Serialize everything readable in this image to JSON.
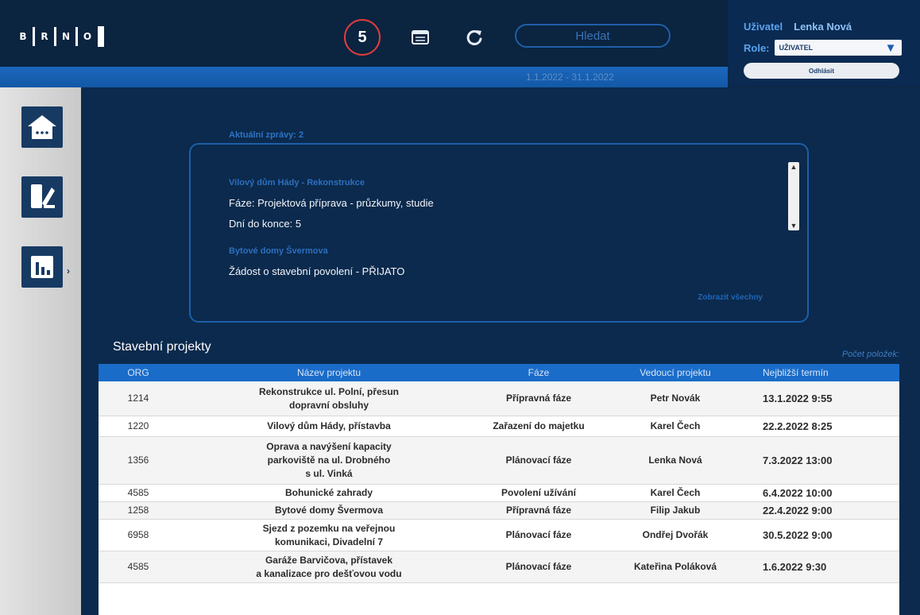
{
  "header": {
    "logo_letters": [
      "B",
      "R",
      "N",
      "O"
    ],
    "notification_count": "5",
    "search_label": "Hledat",
    "date_range": "1.1.2022 - 31.1.2022"
  },
  "user": {
    "label": "Uživatel",
    "name": "Lenka Nová",
    "role_label": "Role:",
    "role_value": "UŽIVATEL",
    "logout_label": "Odhlásit"
  },
  "sidebar": {
    "items": [
      {
        "name": "home",
        "icon": "home-icon"
      },
      {
        "name": "projects",
        "icon": "document-edit-icon"
      },
      {
        "name": "reports",
        "icon": "bar-chart-icon"
      }
    ]
  },
  "notifications": {
    "title": "Aktuální zprávy: 2",
    "items": [
      {
        "link": "Vilový dům Hády - Rekonstrukce",
        "line1": "Fáze: Projektová příprava - průzkumy, studie",
        "line2": "Dní do konce: 5"
      },
      {
        "link": "Bytové domy Švermova",
        "line1": "Žádost o stavební povolení - PŘIJATO"
      }
    ],
    "more_label": "Zobrazit všechny"
  },
  "projects": {
    "title": "Stavební projekty",
    "count_label": "Počet položek:",
    "columns": [
      "ORG",
      "Název projektu",
      "Fáze",
      "Vedoucí projektu",
      "Nejbližší termín"
    ],
    "rows": [
      {
        "org": "1214",
        "name": "Rekonstrukce ul. Polní, přesun\ndopravní obsluhy",
        "faze": "Přípravná fáze",
        "vedouci": "Petr Novák",
        "termin": "13.1.2022 9:55"
      },
      {
        "org": "1220",
        "name": "Vilový dům Hády, přístavba",
        "faze": "Zařazení do majetku",
        "vedouci": "Karel Čech",
        "termin": "22.2.2022 8:25"
      },
      {
        "org": "1356",
        "name": "Oprava a navýšení kapacity\nparkoviště na ul. Drobného\ns ul. Vinká",
        "faze": "Plánovací fáze",
        "vedouci": "Lenka Nová",
        "termin": "7.3.2022 13:00"
      },
      {
        "org": "4585",
        "name": "Bohunické zahrady",
        "faze": "Povolení užívání",
        "vedouci": "Karel Čech",
        "termin": "6.4.2022 10:00"
      },
      {
        "org": "1258",
        "name": "Bytové domy Švermova",
        "faze": "Přípravná fáze",
        "vedouci": "Filip Jakub",
        "termin": "22.4.2022 9:00"
      },
      {
        "org": "6958",
        "name": "Sjezd z pozemku na veřejnou\nkomunikaci, Divadelní 7",
        "faze": "Plánovací fáze",
        "vedouci": "Ondřej Dvořák",
        "termin": "30.5.2022 9:00"
      },
      {
        "org": "4585",
        "name": "Garáže Barvičova, přístavek\na kanalizace pro dešťovou vodu",
        "faze": "Plánovací fáze",
        "vedouci": "Kateřina Poláková",
        "termin": "1.6.2022 9:30"
      }
    ]
  },
  "colors": {
    "app_background": "#0b2a4d",
    "accent_blue": "#1a6cc9",
    "badge_red": "#e03c3c",
    "sidebar_gray": "#d6d6d6"
  }
}
